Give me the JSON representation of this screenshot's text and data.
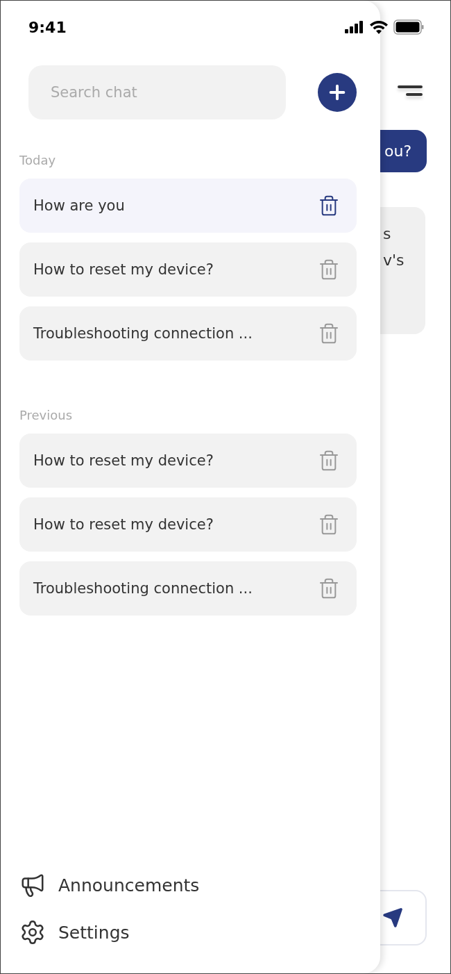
{
  "status_bar": {
    "time": "9:41"
  },
  "search": {
    "placeholder": "Search chat"
  },
  "sections": [
    {
      "title": "Today",
      "chats": [
        {
          "title": "How are you",
          "selected": true
        },
        {
          "title": "How to reset my device?",
          "selected": false
        },
        {
          "title": "Troubleshooting connection ...",
          "selected": false
        }
      ]
    },
    {
      "title": "Previous",
      "chats": [
        {
          "title": "How to reset my device?",
          "selected": false
        },
        {
          "title": "How to reset my device?",
          "selected": false
        },
        {
          "title": "Troubleshooting connection ...",
          "selected": false
        }
      ]
    }
  ],
  "footer": [
    {
      "kind": "announcements",
      "label": "Announcements"
    },
    {
      "kind": "settings",
      "label": "Settings"
    }
  ],
  "chat_behind": {
    "user_message": "ou?",
    "bot_message_lines": [
      "s",
      "v's"
    ]
  }
}
